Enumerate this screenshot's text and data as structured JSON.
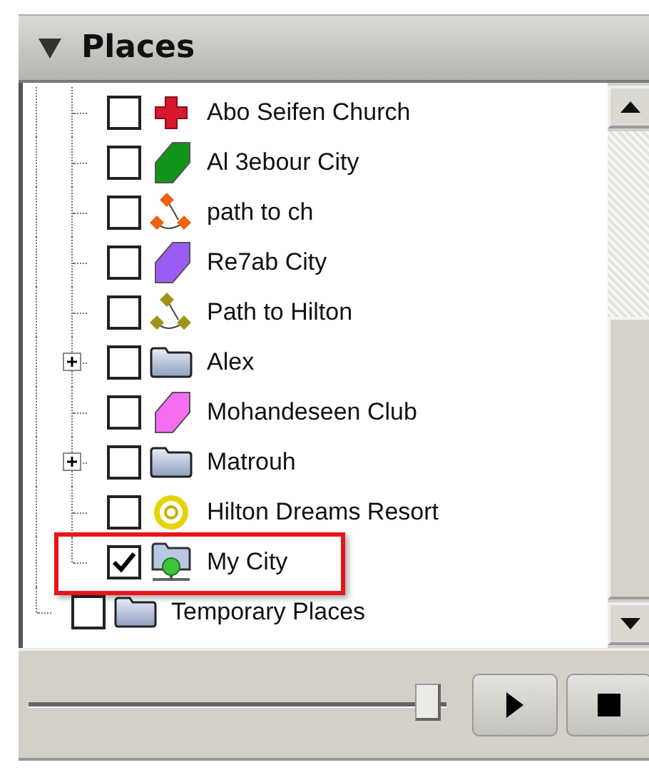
{
  "panel": {
    "title": "Places",
    "expanded": true
  },
  "tree": {
    "items": [
      {
        "children": [
          {
            "label": "Abo Seifen Church",
            "kind": "cross",
            "checked": false,
            "highlighted": false
          },
          {
            "label": "Al 3ebour City",
            "kind": "polygon",
            "color": "#11941a",
            "checked": false,
            "highlighted": false
          },
          {
            "label": "path to ch",
            "kind": "path",
            "color": "#f0620e",
            "checked": false,
            "highlighted": false
          },
          {
            "label": "Re7ab City",
            "kind": "polygon",
            "color": "#9a5cf5",
            "checked": false,
            "highlighted": false
          },
          {
            "label": "Path to Hilton",
            "kind": "path",
            "color": "#a09418",
            "checked": false,
            "highlighted": false
          },
          {
            "label": "Alex",
            "kind": "folder",
            "checked": false,
            "expanded": false,
            "highlighted": false
          },
          {
            "label": "Mohandeseen Club",
            "kind": "polygon",
            "color": "#f56ef0",
            "checked": false,
            "highlighted": false
          },
          {
            "label": "Matrouh",
            "kind": "folder",
            "checked": false,
            "expanded": false,
            "highlighted": false
          },
          {
            "label": "Hilton Dreams Resort",
            "kind": "ring",
            "checked": false,
            "highlighted": false
          },
          {
            "label": "My City",
            "kind": "network",
            "checked": true,
            "highlighted": true
          }
        ]
      },
      {
        "label": "Temporary Places",
        "kind": "folder",
        "checked": false,
        "highlighted": false
      }
    ]
  },
  "player": {
    "level": 0.96
  }
}
